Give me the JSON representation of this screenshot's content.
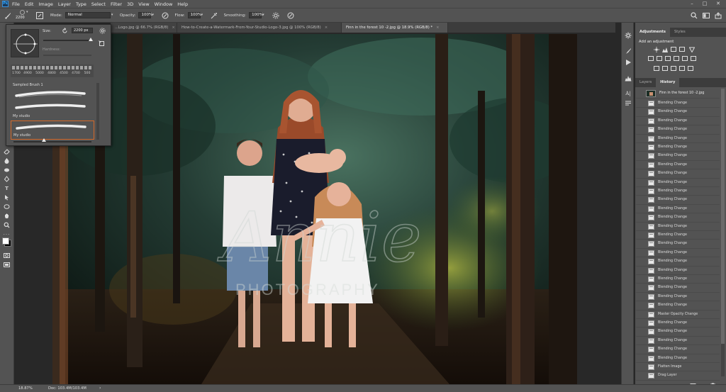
{
  "menu": [
    "File",
    "Edit",
    "Image",
    "Layer",
    "Type",
    "Select",
    "Filter",
    "3D",
    "View",
    "Window",
    "Help"
  ],
  "options": {
    "brush_size": "2200",
    "mode_label": "Mode:",
    "mode_value": "Normal",
    "opacity_label": "Opacity:",
    "opacity_value": "100%",
    "flow_label": "Flow:",
    "flow_value": "100%",
    "smoothing_label": "Smoothing:",
    "smoothing_value": "100%"
  },
  "tabs": [
    {
      "label": "...Logo.jpg @ 66.7% (RGB/8)",
      "active": false
    },
    {
      "label": "How-to-Create-a-Watermark-From-Your-Studio-Logo-3.jpg @ 100% (RGB/8)",
      "active": false
    },
    {
      "label": "Finn in the forest 10 -2.jpg @ 18.9% (RGB/8) *",
      "active": true
    }
  ],
  "brush_panel": {
    "size_label": "Size:",
    "size_value": "2200 px",
    "hardness_label": "Hardness:",
    "preset_sizes": [
      "1700",
      "4900",
      "5000",
      "4800",
      "4500",
      "4700",
      "500"
    ],
    "strokes": [
      {
        "label": "Sampled Brush 1",
        "selected": false,
        "label_top": true
      },
      {
        "label": "My studio",
        "selected": false,
        "label_top": false
      },
      {
        "label": "My studio",
        "selected": true,
        "label_top": false
      }
    ]
  },
  "watermark": {
    "script": "Annie",
    "sub": "PHOTOGRAPHY"
  },
  "right_panel": {
    "adj_tabs": [
      "Adjustments",
      "Styles"
    ],
    "adj_title": "Add an adjustment",
    "hist_tabs": [
      "Layers",
      "History"
    ],
    "snapshot": "Finn in the forest 10 -2.jpg",
    "history": [
      "Blending Change",
      "Blending Change",
      "Blending Change",
      "Blending Change",
      "Blending Change",
      "Blending Change",
      "Blending Change",
      "Blending Change",
      "Blending Change",
      "Blending Change",
      "Blending Change",
      "Blending Change",
      "Blending Change",
      "Blending Change",
      "Blending Change",
      "Blending Change",
      "Blending Change",
      "Blending Change",
      "Blending Change",
      "Blending Change",
      "Blending Change",
      "Blending Change",
      "Blending Change",
      "Blending Change",
      "Master Opacity Change",
      "Blending Change",
      "Blending Change",
      "Blending Change",
      "Blending Change",
      "Blending Change",
      "Flatten Image",
      "Drag Layer"
    ]
  },
  "status": {
    "zoom": "18.87%",
    "doc": "Doc: 103.4M/103.4M"
  },
  "colors": {
    "ui_panel": "#535353",
    "ui_dark": "#3c3c3c",
    "canvas_bg": "#282828",
    "accent": "#31a8ff",
    "selected_outline": "#d4692a"
  }
}
